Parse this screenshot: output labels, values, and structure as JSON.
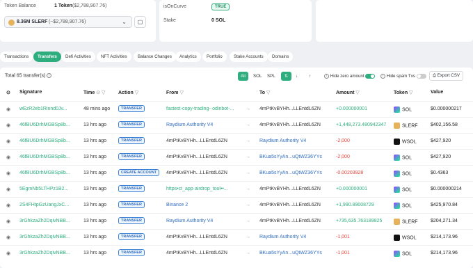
{
  "summary": {
    "token_balance_label": "Token Balance",
    "token_balance_value": "1 Token",
    "token_balance_usd": "($2,788,907.76)",
    "token_select_value": "8.36M SLERF",
    "token_select_usd": "(~$2,788,907.76)",
    "is_on_curve_label": "isOnCurve",
    "is_on_curve_value": "TRUE",
    "stake_label": "Stake",
    "stake_value": "0 SOL"
  },
  "tabs": [
    "Transactions",
    "Transfers",
    "Defi Activities",
    "NFT Activities",
    "Balance Changes",
    "Analytics",
    "Portfolio",
    "Stake Accounts",
    "Domains"
  ],
  "toolbar": {
    "total": "Total 65 transfer(s)",
    "filter_all": "All",
    "filter_sol": "SOL",
    "filter_spl": "SPL",
    "hide_zero": "Hide zero amount",
    "hide_spam": "Hide spam Txs",
    "export": "Export CSV"
  },
  "columns": {
    "signature": "Signature",
    "time": "Time",
    "action": "Action",
    "from": "From",
    "to": "To",
    "amount": "Amount",
    "token": "Token",
    "value": "Value"
  },
  "rows": [
    {
      "sig": "wEzR2eb1Rinnd0Jv...",
      "time": "48 mins ago",
      "action": "TRANSFER",
      "from": "fastest-copy-trading-·odinbot-...",
      "to": "4mPtKvBYHh...LLEntdL6ZN",
      "amount": "+0.000000001",
      "token": "SOL",
      "value": "$0.000000217"
    },
    {
      "sig": "46fBU6DrhMGBSp8b...",
      "time": "13 hrs ago",
      "action": "TRANSFER",
      "from": "Raydium Authority V4",
      "to": "4mPtKvBYHh...LLEntdL6ZN",
      "amount": "+1,448,273.480942347",
      "token": "SLERF",
      "value": "$402,156.58"
    },
    {
      "sig": "46fBU6DrhMGBSp8b...",
      "time": "13 hrs ago",
      "action": "TRANSFER",
      "from": "4mPtKvBYHh...LLEntdL6ZN",
      "to": "Raydium Authority V4",
      "amount": "-2,000",
      "token": "WSOL",
      "value": "$427,920"
    },
    {
      "sig": "46fBU6DrhMGBSp8b...",
      "time": "13 hrs ago",
      "action": "TRANSFER",
      "from": "4mPtKvBYHh...LLEntdL6ZN",
      "to": "BKua5sYyAn...uQtWZ36YYs",
      "amount": "-2,000",
      "token": "SOL",
      "value": "$427,920"
    },
    {
      "sig": "46fBU6DrhMGBSp8b...",
      "time": "13 hrs ago",
      "action": "CREATE ACCOUNT",
      "from": "4mPtKvBYHh...LLEntdL6ZN",
      "to": "BKua5sYyAn...uQtWZ36YYs",
      "amount": "-0.00203928",
      "token": "SOL",
      "value": "$0.4363"
    },
    {
      "sig": "5EgmNb5LTHPz1B2...",
      "time": "13 hrs ago",
      "action": "TRANSFER",
      "from": "https•ct_app·airdrop_tool••...",
      "to": "4mPtKvBYHh...LLEntdL6ZN",
      "amount": "+0.000000001",
      "token": "SOL",
      "value": "$0.000000214"
    },
    {
      "sig": "2S4FHtpGzUangJxC...",
      "time": "13 hrs ago",
      "action": "TRANSFER",
      "from": "Binance 2",
      "to": "4mPtKvBYHh...LLEntdL6ZN",
      "amount": "+1,990.89008729",
      "token": "SOL",
      "value": "$425,970.84"
    },
    {
      "sig": "3rGhkzaZh2DqivNBB...",
      "time": "13 hrs ago",
      "action": "TRANSFER",
      "from": "Raydium Authority V4",
      "to": "4mPtKvBYHh...LLEntdL6ZN",
      "amount": "+735,635.763189825",
      "token": "SLERF",
      "value": "$204,271.34"
    },
    {
      "sig": "3rGhkzaZh2DqivNBB...",
      "time": "13 hrs ago",
      "action": "TRANSFER",
      "from": "4mPtKvBYHh...LLEntdL6ZN",
      "to": "Raydium Authority V4",
      "amount": "-1,001",
      "token": "WSOL",
      "value": "$214,173.96"
    },
    {
      "sig": "3rGhkzaZh2DqivNBB...",
      "time": "13 hrs ago",
      "action": "TRANSFER",
      "from": "4mPtKvBYHh...LLEntdL6ZN",
      "to": "BKua5sYyAn...uQtWZ36YYs",
      "amount": "-1,001",
      "token": "SOL",
      "value": "$214,173.96"
    }
  ],
  "colors": {
    "accent": "#2eae7f",
    "link": "#2f6cc0",
    "negative": "#e0433a"
  }
}
